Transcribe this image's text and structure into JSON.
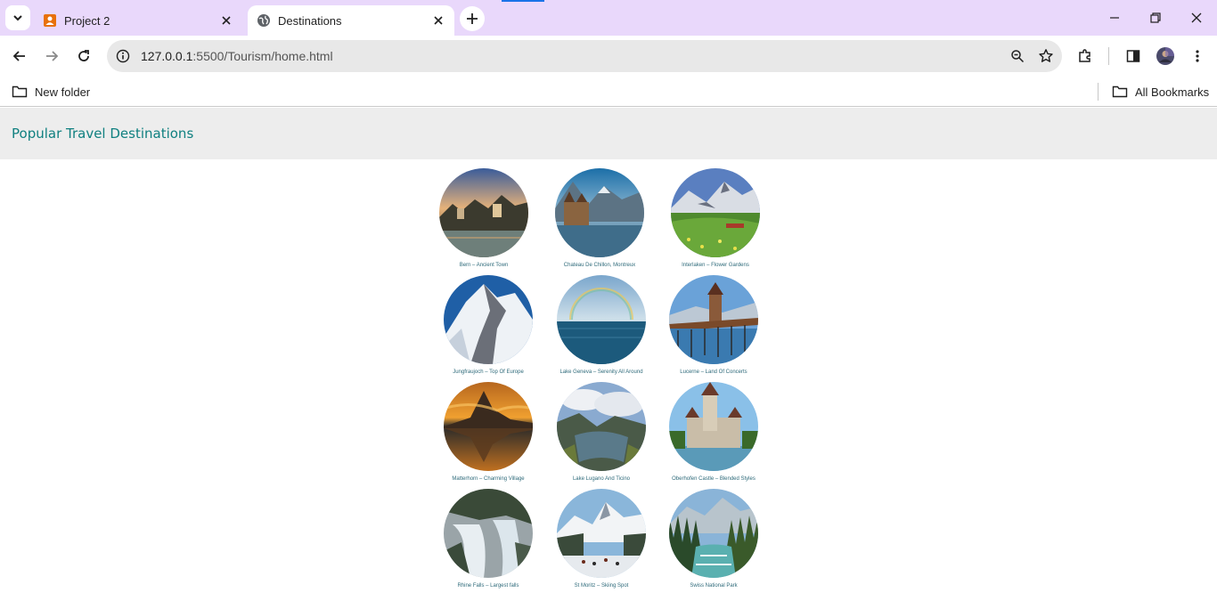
{
  "browser": {
    "tabs": [
      {
        "title": "Project 2",
        "active": false,
        "favicon": "project-favicon-icon"
      },
      {
        "title": "Destinations",
        "active": true,
        "favicon": "globe-favicon-icon"
      }
    ],
    "url_host": "127.0.0.1",
    "url_path": ":5500/Tourism/home.html",
    "bookmarks": {
      "left_folder": "New folder",
      "right_folder": "All Bookmarks"
    }
  },
  "page": {
    "title": "Popular Travel Destinations",
    "accent_color": "#108080",
    "destinations": [
      {
        "caption": "Bern – Ancient Town"
      },
      {
        "caption": "Chateau De Chillon, Montreux"
      },
      {
        "caption": "Interlaken – Flower Gardens"
      },
      {
        "caption": "Jungfraujoch – Top Of Europe"
      },
      {
        "caption": "Lake Geneva – Serenity All Around"
      },
      {
        "caption": "Lucerne – Land Of Concerts"
      },
      {
        "caption": "Matterhorn – Charming Village"
      },
      {
        "caption": "Lake Lugano And Ticino"
      },
      {
        "caption": "Oberhofen Castle – Blended Styles"
      },
      {
        "caption": "Rhine Falls – Largest falls"
      },
      {
        "caption": "St Moritz – Skiing Spot"
      },
      {
        "caption": "Swiss National Park"
      }
    ]
  }
}
